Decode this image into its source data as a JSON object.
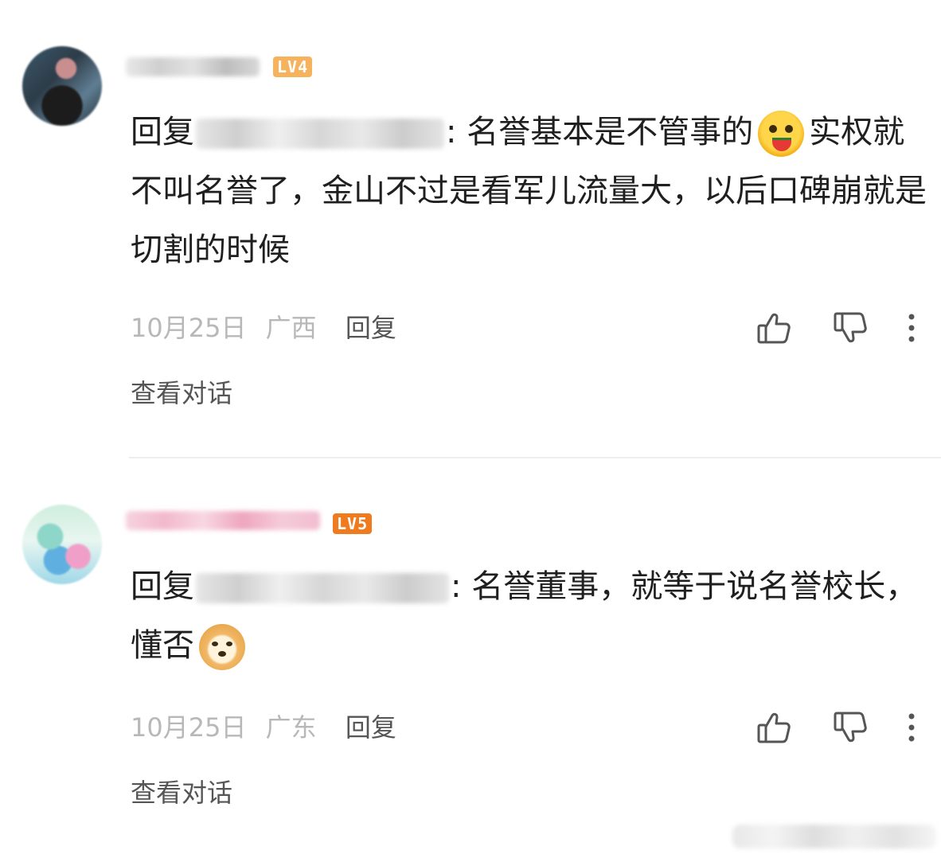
{
  "comments": [
    {
      "level": "LV4",
      "reply_prefix": "回复",
      "text_before_emoji": ": 名誉基本是不管事的",
      "emoji": "laughing-watermelon-emoji",
      "text_after_emoji": "实权就不叫名誉了，金山不过是看军儿流量大，以后口碑崩就是切割的时候",
      "date": "10月25日",
      "location": "广西",
      "reply_label": "回复",
      "view_conversation": "查看对话"
    },
    {
      "level": "LV5",
      "reply_prefix": "回复",
      "text_before_emoji": ": 名誉董事，就等于说名誉校长，懂否",
      "emoji": "doge-emoji",
      "text_after_emoji": "",
      "date": "10月25日",
      "location": "广东",
      "reply_label": "回复",
      "view_conversation": "查看对话"
    }
  ],
  "icons": {
    "like": "thumbs-up-icon",
    "dislike": "thumbs-down-icon",
    "more": "more-vertical-icon"
  },
  "colors": {
    "text": "#1f1f1f",
    "meta": "#b8b8b8",
    "action": "#555555",
    "lv4": "#f6b25c",
    "lv5": "#f07a1e"
  }
}
